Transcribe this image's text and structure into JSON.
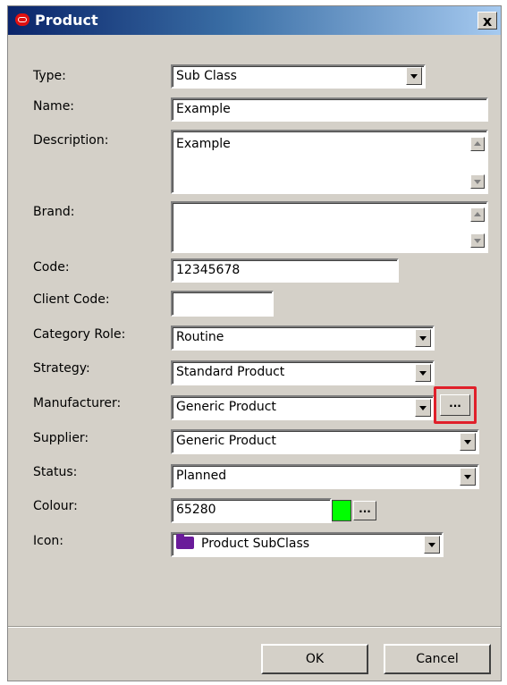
{
  "window": {
    "title": "Product",
    "close_label": "x"
  },
  "fields": {
    "type": {
      "label": "Type:",
      "value": "Sub Class"
    },
    "name": {
      "label": "Name:",
      "value": "Example"
    },
    "description": {
      "label": "Description:",
      "value": "Example"
    },
    "brand": {
      "label": "Brand:",
      "value": ""
    },
    "code": {
      "label": "Code:",
      "value": "12345678"
    },
    "client_code": {
      "label": "Client Code:",
      "value": ""
    },
    "category_role": {
      "label": "Category Role:",
      "value": "Routine"
    },
    "strategy": {
      "label": "Strategy:",
      "value": "Standard Product"
    },
    "manufacturer": {
      "label": "Manufacturer:",
      "value": "Generic Product",
      "browse_label": "..."
    },
    "supplier": {
      "label": "Supplier:",
      "value": "Generic Product"
    },
    "status": {
      "label": "Status:",
      "value": "Planned"
    },
    "colour": {
      "label": "Colour:",
      "value": "65280",
      "swatch_color": "#00ff00",
      "browse_label": "..."
    },
    "icon": {
      "label": "Icon:",
      "value": "Product SubClass",
      "icon_name": "folder-icon",
      "icon_color": "#6a1b9a"
    }
  },
  "buttons": {
    "ok": "OK",
    "cancel": "Cancel"
  },
  "colors": {
    "titlebar_start": "#0a246a",
    "dialog_bg": "#d4d0c8",
    "highlight": "#e0202a"
  }
}
